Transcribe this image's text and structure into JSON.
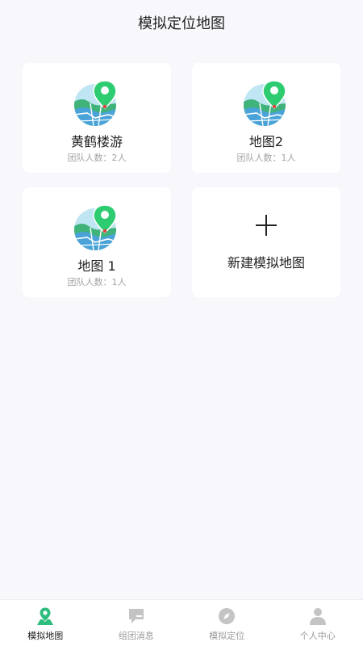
{
  "header": {
    "title": "模拟定位地图"
  },
  "cards": [
    {
      "name": "黄鹤楼游",
      "members": "团队人数：2人"
    },
    {
      "name": "地图2",
      "members": "团队人数：1人"
    },
    {
      "name": "地图 1",
      "members": "团队人数：1人"
    }
  ],
  "new_card": {
    "label": "新建模拟地图",
    "icon": "plus-icon"
  },
  "tabs": [
    {
      "label": "模拟地图",
      "icon": "map-pin-icon",
      "active": true
    },
    {
      "label": "组团消息",
      "icon": "chat-icon",
      "active": false
    },
    {
      "label": "模拟定位",
      "icon": "compass-icon",
      "active": false
    },
    {
      "label": "个人中心",
      "icon": "person-icon",
      "active": false
    }
  ],
  "colors": {
    "accent": "#2dbd7d",
    "inactive": "#c4c4c4",
    "background": "#f8f7fb"
  }
}
